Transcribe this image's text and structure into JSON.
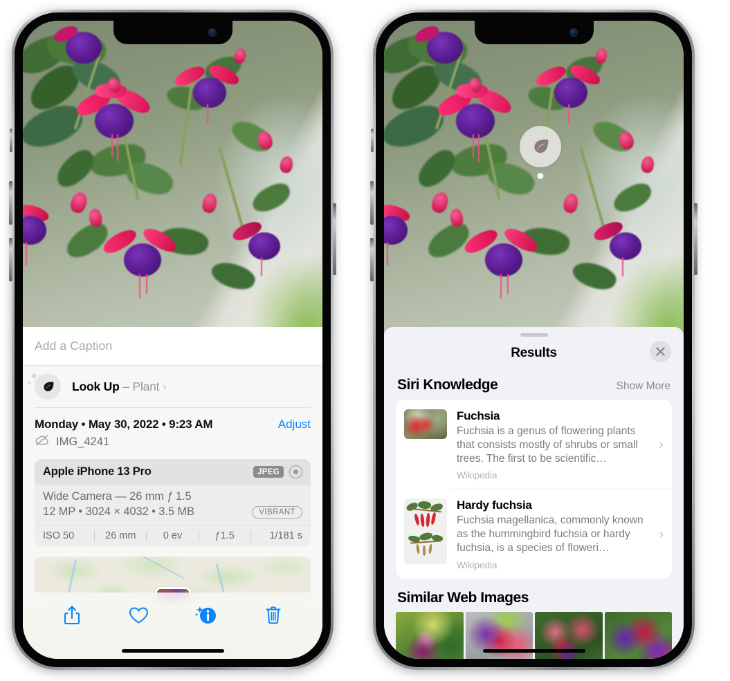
{
  "left_phone": {
    "caption_field": {
      "placeholder": "Add a Caption",
      "value": ""
    },
    "look_up": {
      "icon": "leaf-icon",
      "label": "Look Up",
      "dash": " – ",
      "subject": "Plant",
      "chevron": "›"
    },
    "date_row": {
      "date_text": "Monday • May 30, 2022 • 9:23 AM",
      "adjust_label": "Adjust"
    },
    "file_row": {
      "icon": "cloud-slash-icon",
      "file_name": "IMG_4241"
    },
    "exif": {
      "model": "Apple iPhone 13 Pro",
      "format_badge": "JPEG",
      "raw_icon": "aperture-icon",
      "lens_line": "Wide Camera — 26 mm ƒ 1.5",
      "size_line": "12 MP • 3024 × 4032 • 3.5 MB",
      "style_badge": "VIBRANT",
      "stats": [
        "ISO 50",
        "26 mm",
        "0 ev",
        "ƒ1.5",
        "1/181 s"
      ]
    },
    "toolbar": [
      {
        "name": "share-button",
        "icon": "share-icon"
      },
      {
        "name": "favorite-button",
        "icon": "heart-icon"
      },
      {
        "name": "info-button",
        "icon": "info-sparkle-icon"
      },
      {
        "name": "delete-button",
        "icon": "trash-icon"
      }
    ],
    "accent_color": "#0a84ff"
  },
  "right_phone": {
    "visual_lookup_badge": {
      "icon": "leaf-icon"
    },
    "sheet": {
      "title": "Results",
      "close_icon": "close-icon",
      "siri_knowledge": {
        "section_title": "Siri Knowledge",
        "show_more": "Show More",
        "items": [
          {
            "title": "Fuchsia",
            "description": "Fuchsia is a genus of flowering plants that consists mostly of shrubs or small trees. The first to be scientific…",
            "source": "Wikipedia",
            "chevron": "›"
          },
          {
            "title": "Hardy fuchsia",
            "description": "Fuchsia magellanica, commonly known as the hummingbird fuchsia or hardy fuchsia, is a species of floweri…",
            "source": "Wikipedia",
            "chevron": "›"
          }
        ]
      },
      "similar_web_images": {
        "section_title": "Similar Web Images",
        "thumbnail_count": 4
      }
    }
  }
}
